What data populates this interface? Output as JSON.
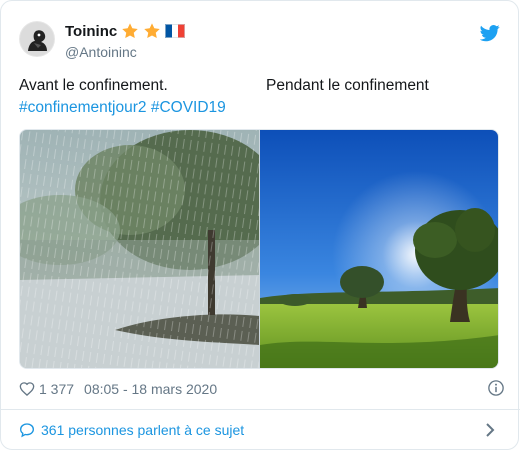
{
  "author": {
    "display_name": "Toininc",
    "handle": "@Antoininc",
    "name_emojis": [
      "star-icon",
      "star-icon",
      "france-flag-icon"
    ]
  },
  "tweet": {
    "text_left": "Avant le confinement.",
    "text_right": "Pendant le confinement",
    "hashtags": [
      "#confinementjour2",
      "#COVID19"
    ],
    "media": [
      {
        "icon": "rainy-road-photo"
      },
      {
        "icon": "sunny-meadow-photo"
      }
    ]
  },
  "meta": {
    "like_count": "1 377",
    "timestamp": "08:05 - 18 mars 2020"
  },
  "footer": {
    "conversation_label": "361 personnes parlent à ce sujet"
  },
  "colors": {
    "accent": "#1b95e0",
    "text": "#14171a",
    "secondary": "#657786",
    "border": "#e1e8ed",
    "star": "#ffac33"
  }
}
